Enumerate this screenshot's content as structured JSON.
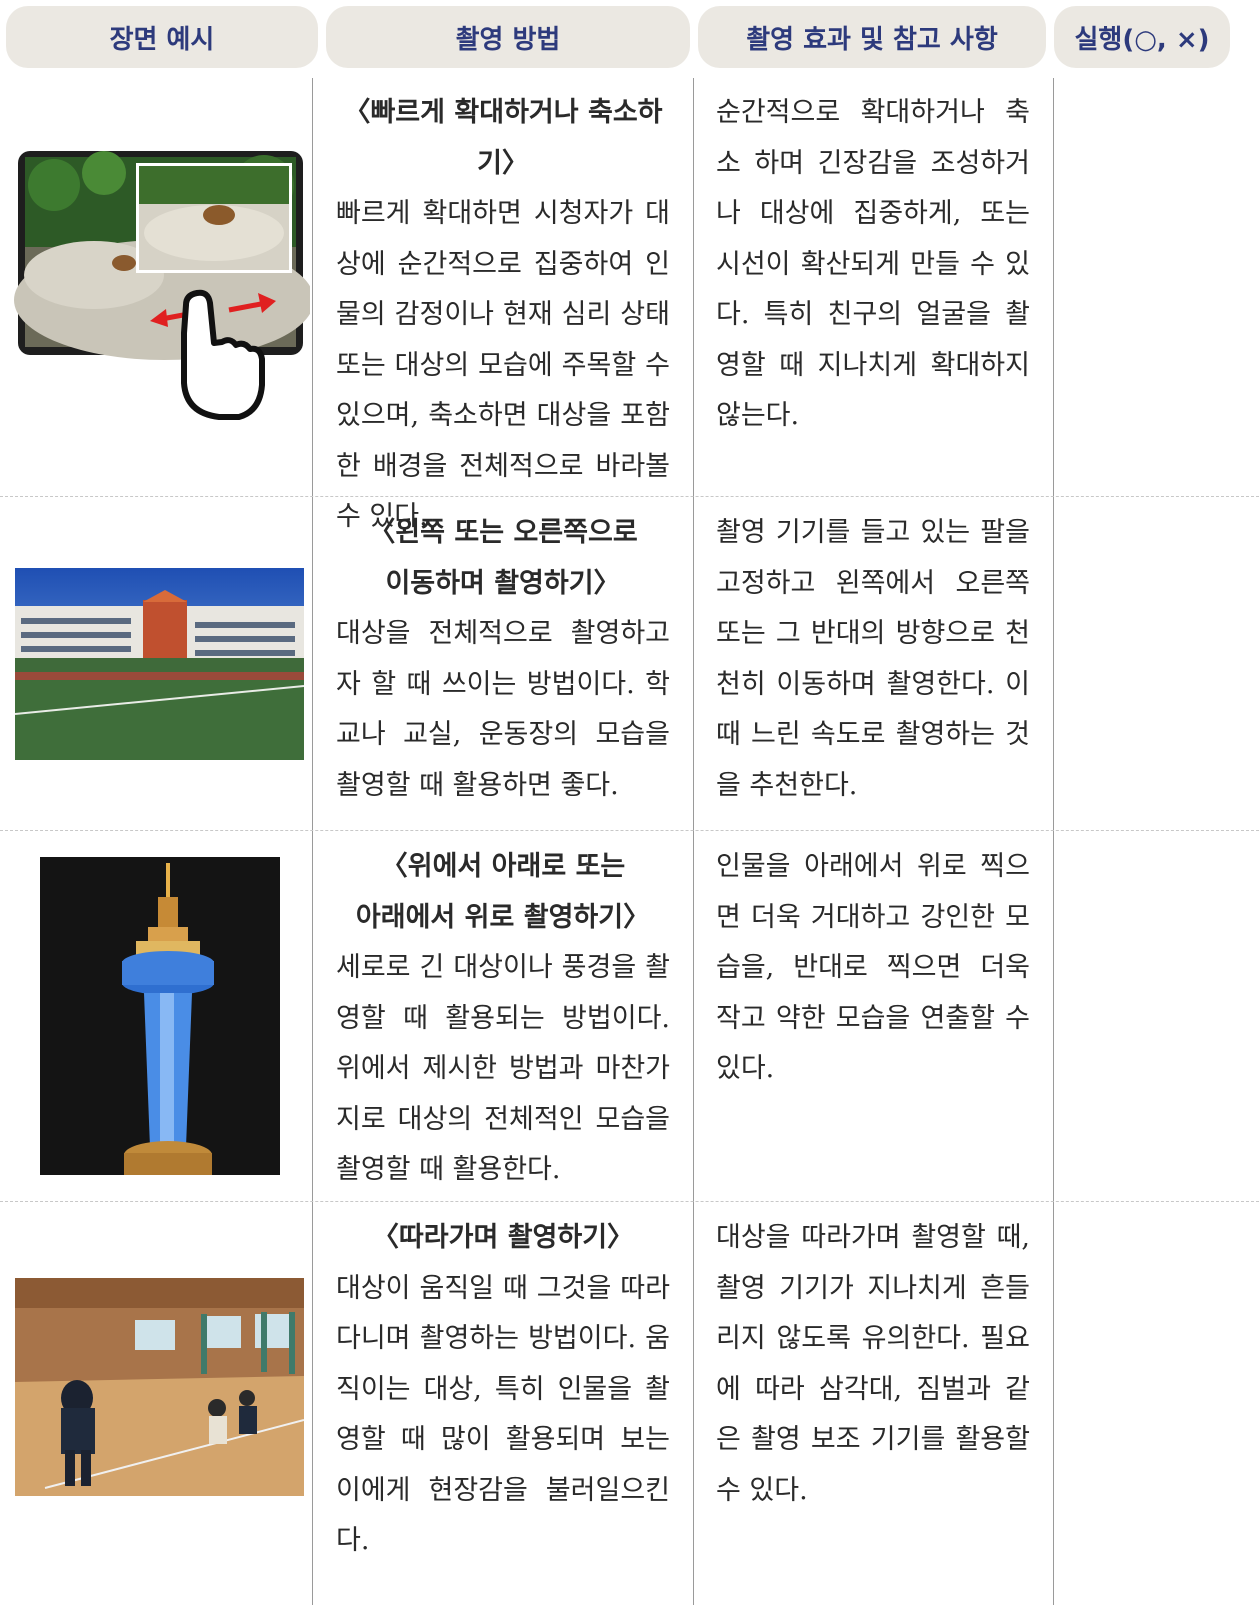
{
  "headers": {
    "scene": "장면 예시",
    "method": "촬영 방법",
    "effect": "촬영 효과 및 참고 사항",
    "check": "실행(○, ×)"
  },
  "rows": [
    {
      "method_title": "〈빠르게 확대하거나 축소하기〉",
      "method_body": "빠르게 확대하면 시청자가 대상에 순간적으로 집중하여 인물의 감정이나 현재 심리 상태 또는 대상의 모습에 주목할 수 있으며, 축소하면 대상을 포함한 배경을 전체적으로 바라볼 수 있다.",
      "effect": "순간적으로 확대하거나 축소 하며 긴장감을 조성하거나 대상에 집중하게, 또는 시선이 확산되게 만들 수 있다. 특히 친구의 얼굴을 촬영할 때 지나치게 확대하지 않는다.",
      "check": ""
    },
    {
      "method_title": "〈왼쪽 또는 오른쪽으로\n이동하며 촬영하기〉",
      "method_body": "대상을 전체적으로 촬영하고자 할 때 쓰이는 방법이다. 학교나 교실, 운동장의 모습을 촬영할 때 활용하면 좋다.",
      "effect": "촬영 기기를 들고 있는 팔을 고정하고 왼쪽에서 오른쪽 또는 그 반대의 방향으로 천천히 이동하며 촬영한다. 이때 느린 속도로 촬영하는 것을 추천한다.",
      "check": ""
    },
    {
      "method_title": "〈위에서 아래로 또는\n아래에서 위로 촬영하기〉",
      "method_body": "세로로 긴 대상이나 풍경을 촬영할 때 활용되는 방법이다. 위에서 제시한 방법과 마찬가지로 대상의 전체적인 모습을 촬영할 때 활용한다.",
      "effect": "인물을 아래에서 위로 찍으면 더욱 거대하고 강인한 모습을, 반대로 찍으면 더욱 작고 약한 모습을 연출할 수 있다.",
      "check": ""
    },
    {
      "method_title": "〈따라가며 촬영하기〉",
      "method_body": "대상이 움직일 때 그것을 따라다니며 촬영하는 방법이다. 움직이는 대상, 특히 인물을 촬영할 때 많이 활용되며 보는 이에게 현장감을 불러일으킨다.",
      "effect": "대상을 따라가며 촬영할 때, 촬영 기기가 지나치게 흔들리지 않도록 유의한다. 필요에 따라 삼각대, 짐벌과 같은 촬영 보조 기기를 활용할 수 있다.",
      "check": ""
    }
  ]
}
